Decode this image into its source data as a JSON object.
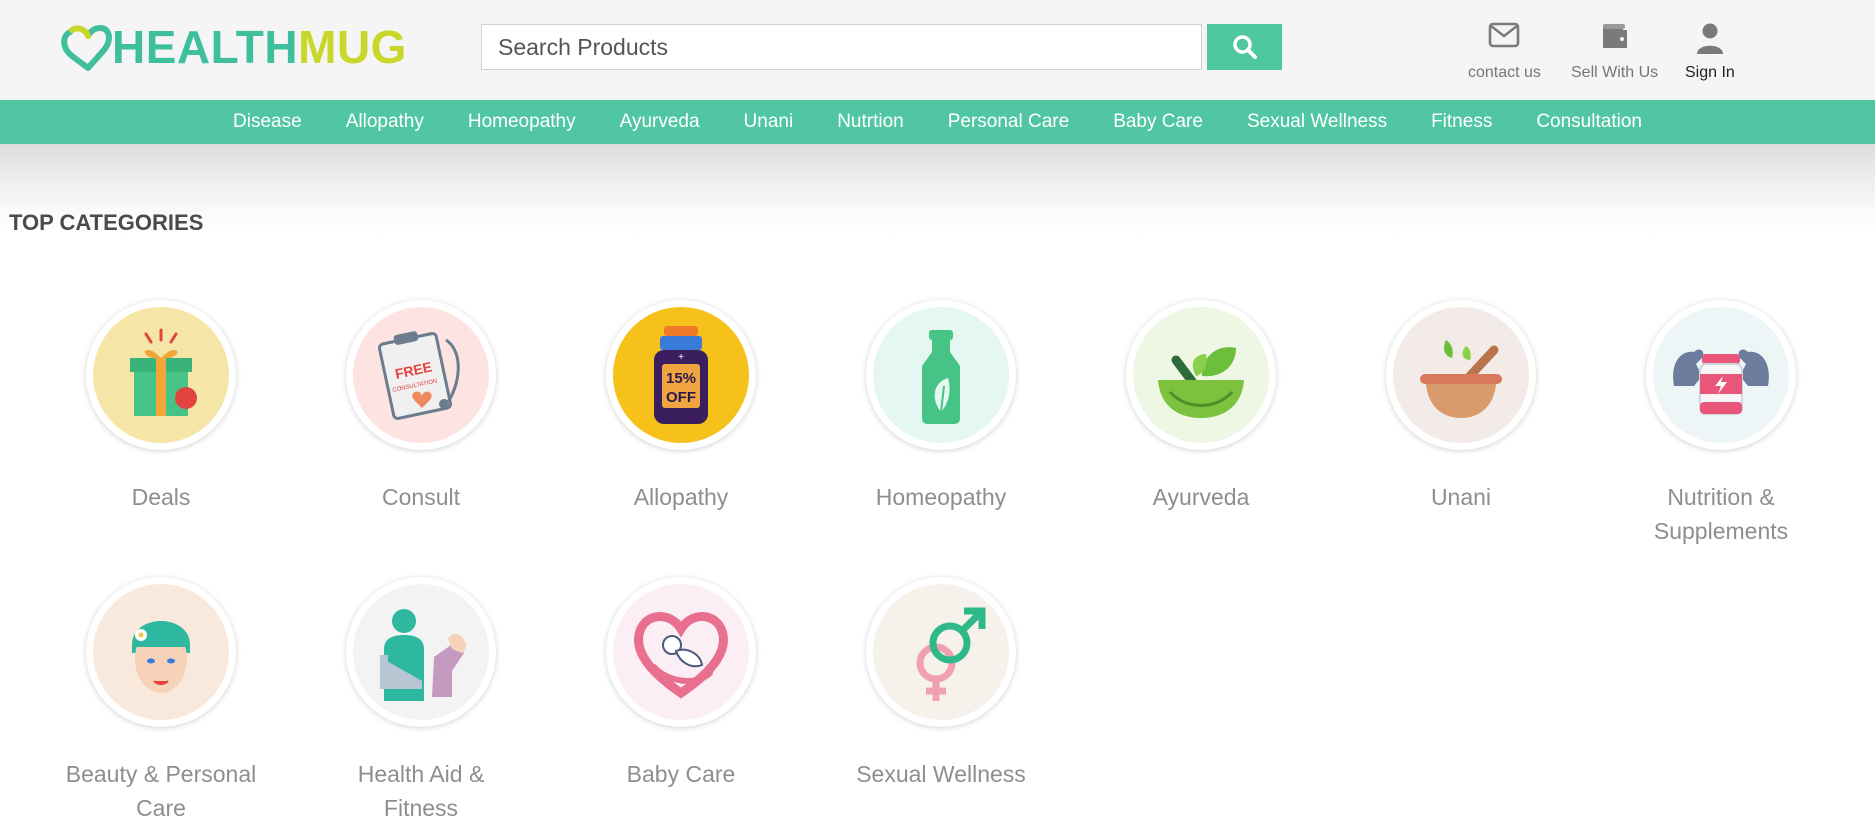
{
  "header": {
    "logo": {
      "part1": "HEALTH",
      "part2": "MUG"
    },
    "search": {
      "placeholder": "Search Products",
      "value": ""
    },
    "links": {
      "contact": "contact us",
      "sell": "Sell With Us",
      "signin": "Sign In"
    }
  },
  "nav": {
    "items": [
      "Disease",
      "Allopathy",
      "Homeopathy",
      "Ayurveda",
      "Unani",
      "Nutrtion",
      "Personal Care",
      "Baby Care",
      "Sexual Wellness",
      "Fitness",
      "Consultation"
    ]
  },
  "categories": {
    "title": "TOP CATEGORIES",
    "items": [
      {
        "label": "Deals",
        "icon": "gift-icon"
      },
      {
        "label": "Consult",
        "icon": "clipboard-stethoscope-icon"
      },
      {
        "label": "Allopathy",
        "icon": "medicine-bottle-icon"
      },
      {
        "label": "Homeopathy",
        "icon": "leaf-bottle-icon"
      },
      {
        "label": "Ayurveda",
        "icon": "mortar-leaves-icon"
      },
      {
        "label": "Unani",
        "icon": "mortar-pestle-icon"
      },
      {
        "label": "Nutrition & Supplements",
        "icon": "supplement-muscle-icon"
      },
      {
        "label": "Beauty & Personal Care",
        "icon": "woman-face-icon"
      },
      {
        "label": "Health Aid & Fitness",
        "icon": "sling-bandage-icon"
      },
      {
        "label": "Baby Care",
        "icon": "heart-baby-icon"
      },
      {
        "label": "Sexual Wellness",
        "icon": "gender-symbols-icon"
      }
    ],
    "icon_text": {
      "free": "FREE",
      "consultation": "CONSULTATION",
      "percent": "15%",
      "off": "OFF",
      "pct_sign": "%"
    }
  },
  "colors": {
    "brand_green": "#4fc8a2",
    "brand_lime": "#c9d62a",
    "header_bg": "#f5f5f5"
  }
}
